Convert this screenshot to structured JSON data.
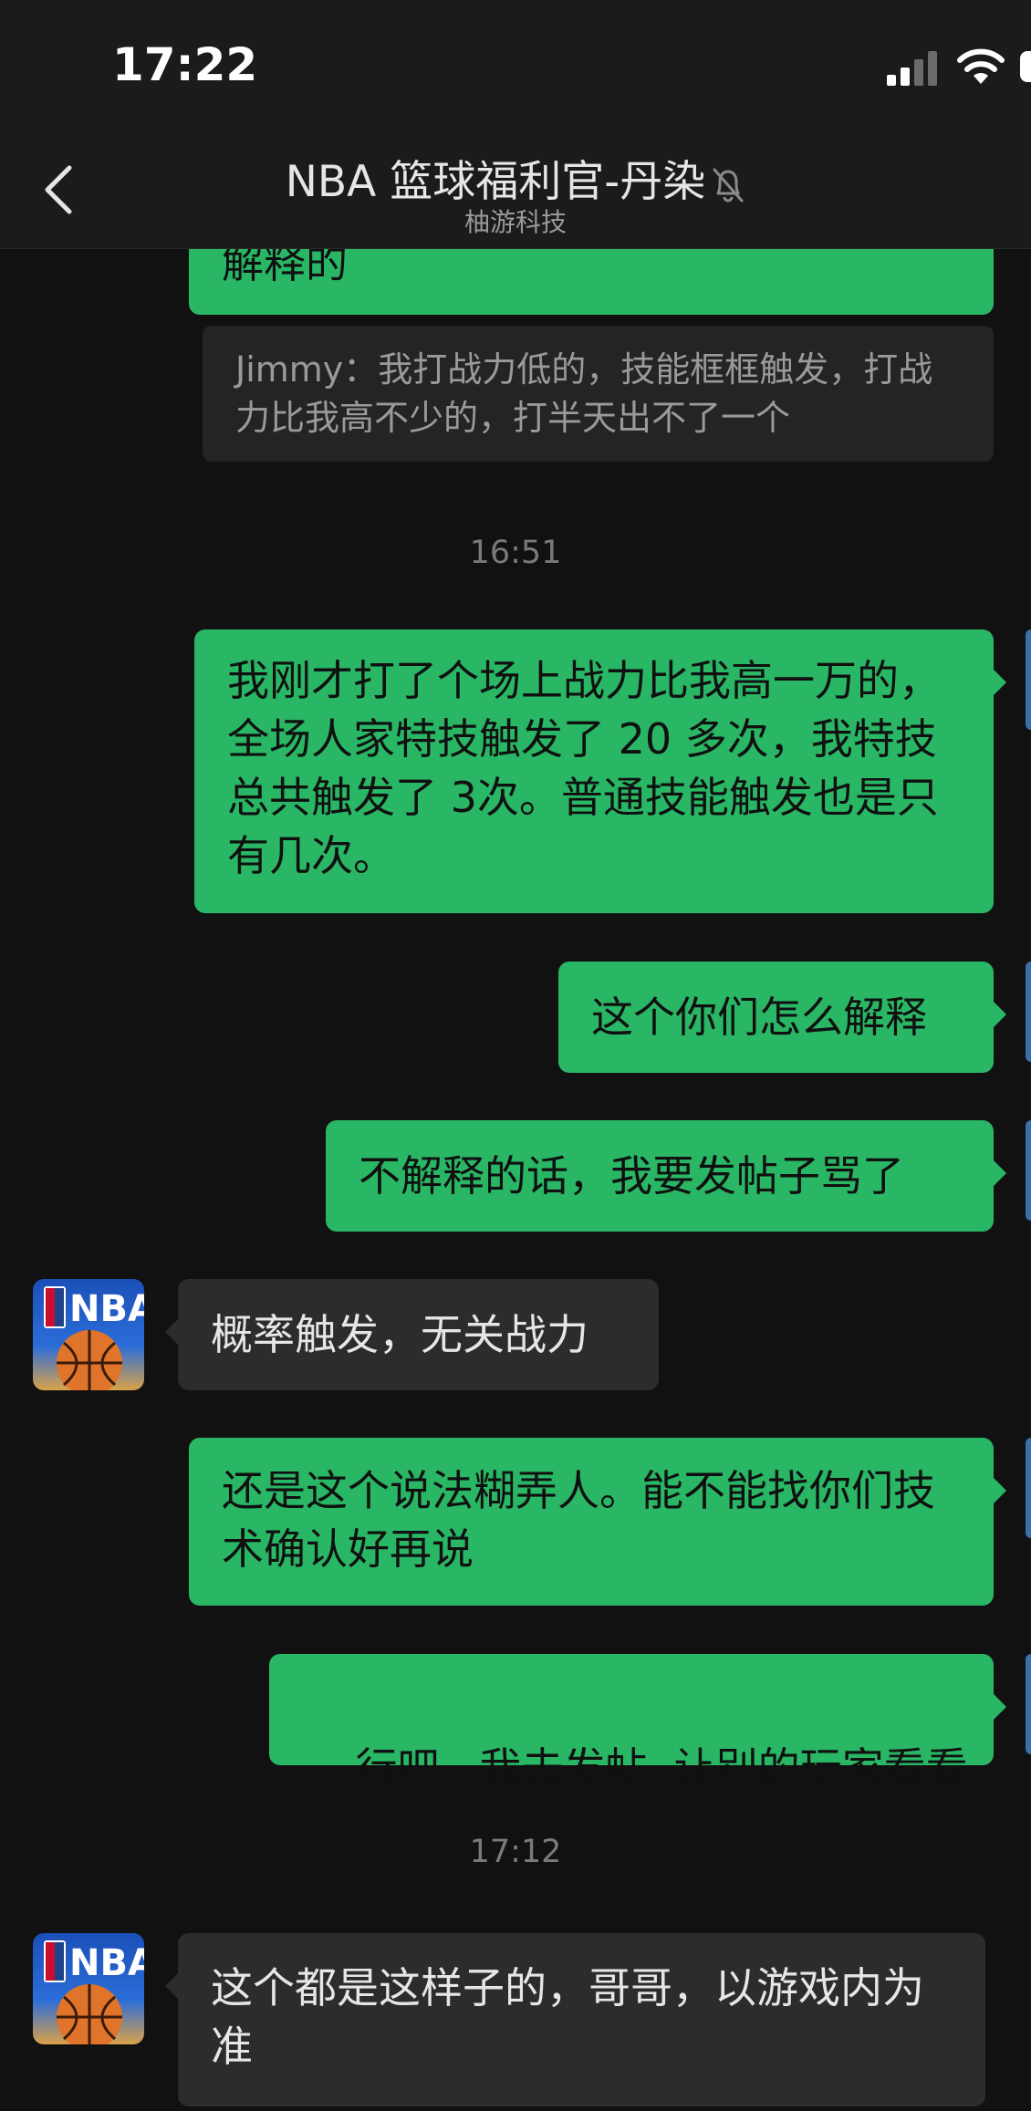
{
  "status_bar": {
    "time": "17:22"
  },
  "header": {
    "title": "NBA 篮球福利官-丹染",
    "subtitle": "柚游科技",
    "mute_icon": "bell-slash-icon",
    "back_icon": "chevron-left-icon"
  },
  "messages": {
    "cut_top": "解释的",
    "quote": "Jimmy：我打战力低的，技能框框触发，打战力比我高不少的，打半天出不了一个",
    "time_1": "16:51",
    "out_1": "我刚才打了个场上战力比我高一万的，全场人家特技触发了 20 多次，我特技总共触发了 3次。普通技能触发也是只有几次。",
    "out_2": "这个你们怎么解释",
    "out_3": "不解释的话，我要发帖子骂了",
    "in_1": "概率触发，无关战力",
    "out_4": "还是这个说法糊弄人。能不能找你们技术确认好再说",
    "out_5": "行吧   我去发帖  让别的玩家看看",
    "time_2": "17:12",
    "in_2": "这个都是这样子的，哥哥，以游戏内为准"
  },
  "avatar_logo_text": "NBA",
  "colors": {
    "outgoing_bubble": "#29b765",
    "incoming_bubble": "#2c2c2c",
    "background": "#111111",
    "header": "#1b1b1b"
  }
}
